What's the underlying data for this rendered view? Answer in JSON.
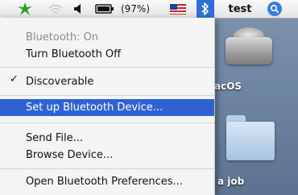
{
  "menubar": {
    "battery_text": "(97%)",
    "user": "test",
    "items": [
      {
        "icon": "bluetooth-extra-icon"
      },
      {
        "icon": "wifi-icon"
      },
      {
        "icon": "volume-icon"
      },
      {
        "icon": "battery-icon"
      },
      {
        "icon": "us-flag-icon"
      },
      {
        "icon": "bluetooth-icon"
      },
      {
        "icon": "spotlight-icon"
      }
    ]
  },
  "menu": {
    "status": "Bluetooth: On",
    "turn_off": "Turn Bluetooth Off",
    "discoverable": "Discoverable",
    "discoverable_checked": true,
    "setup": "Set up Bluetooth Device...",
    "send_file": "Send File...",
    "browse_device": "Browse Device...",
    "open_prefs": "Open Bluetooth Preferences..."
  },
  "desktop": {
    "hdd_label": "acOS",
    "folder_label": "a job"
  },
  "colors": {
    "highlight": "#2e62d0",
    "bluetooth_active": "#2f6fd6"
  }
}
